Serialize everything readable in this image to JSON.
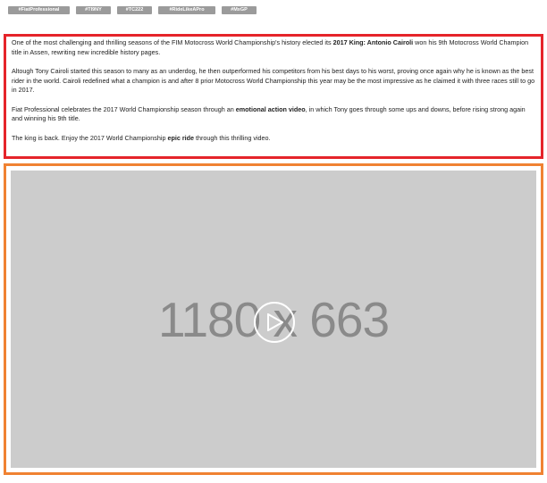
{
  "tags": [
    "#FiatProfessional",
    "#TI9NY",
    "#TC222",
    "#RideLikeAPro",
    "#MxGP"
  ],
  "description": {
    "p1_pre": "One of the most challenging and thrilling seasons of the FIM Motocross World Championship's history elected its ",
    "p1_bold": "2017 King: Antonio Cairoli",
    "p1_post": " won his 9th Motocross World Champion title in Assen, rewriting new incredible history pages.",
    "p2": "Altough Tony Cairoli started this season to many as an underdog, he then outperformed his competitors from his best days to his worst, proving once again why he is known as the best rider in the world. Cairoli redefined what a champion is and after 8 prior Motocross World Championship this year may be the most impressive as he claimed it with three races still to go in 2017.",
    "p3_pre": "Fiat Professional celebrates the 2017 World Championship season through an ",
    "p3_bold": "emotional action video",
    "p3_post": ", in which Tony goes through some ups and downs, before rising strong again and winning his 9th title.",
    "p4_pre": "The king is back. Enjoy the 2017 World Championship ",
    "p4_bold": "epic ride",
    "p4_post": " through this thrilling video."
  },
  "video": {
    "placeholder_text": "1180 x 663",
    "play_icon": "play-circle-icon"
  },
  "colors": {
    "text_border": "#e5242a",
    "video_border": "#f08232",
    "tag_bg": "#9b9b9b",
    "video_bg": "#cccccc"
  }
}
